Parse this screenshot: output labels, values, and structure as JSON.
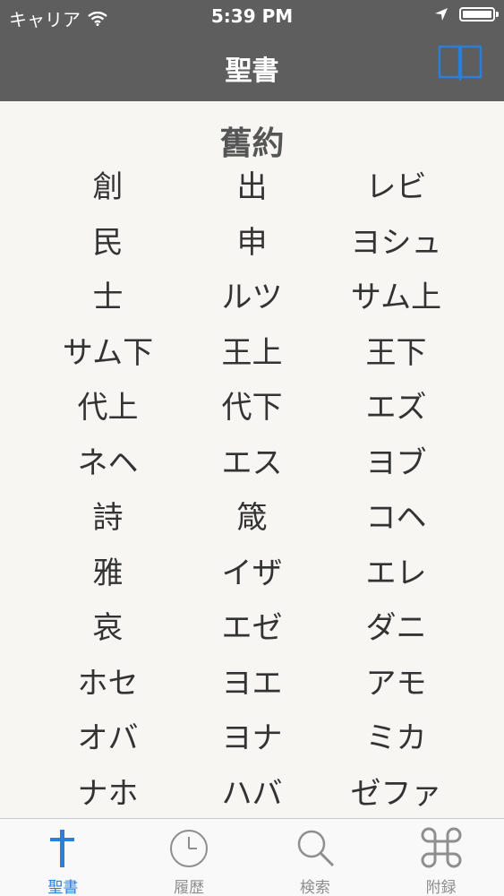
{
  "status_bar": {
    "carrier": "キャリア",
    "time": "5:39 PM"
  },
  "nav": {
    "title": "聖書"
  },
  "section": {
    "title": "舊約"
  },
  "books": [
    "創",
    "出",
    "レビ",
    "民",
    "申",
    "ヨシュ",
    "士",
    "ルツ",
    "サム上",
    "サム下",
    "王上",
    "王下",
    "代上",
    "代下",
    "エズ",
    "ネヘ",
    "エス",
    "ヨブ",
    "詩",
    "箴",
    "コヘ",
    "雅",
    "イザ",
    "エレ",
    "哀",
    "エゼ",
    "ダニ",
    "ホセ",
    "ヨエ",
    "アモ",
    "オバ",
    "ヨナ",
    "ミカ",
    "ナホ",
    "ハバ",
    "ゼファ"
  ],
  "tabs": [
    {
      "label": "聖書",
      "icon": "cross-icon",
      "active": true
    },
    {
      "label": "履歴",
      "icon": "clock-icon",
      "active": false
    },
    {
      "label": "検索",
      "icon": "search-icon",
      "active": false
    },
    {
      "label": "附録",
      "icon": "command-icon",
      "active": false
    }
  ],
  "colors": {
    "accent": "#2b7fd6",
    "header": "#5e5e5e",
    "background": "#f7f6f3",
    "tab_inactive": "#8e8e8e"
  }
}
